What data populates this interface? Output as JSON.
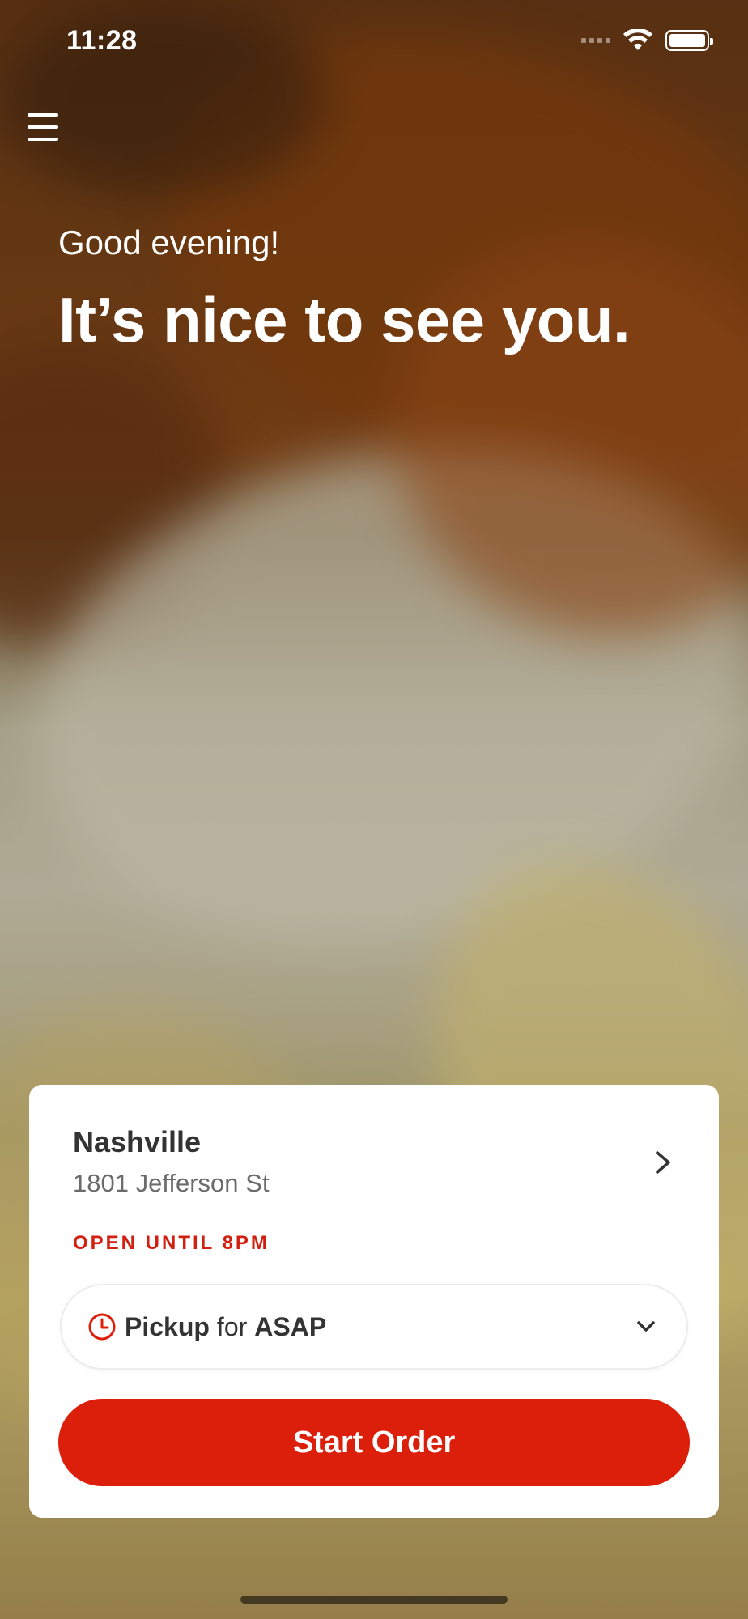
{
  "status_bar": {
    "time": "11:28"
  },
  "icons": {
    "menu": "hamburger-menu-icon",
    "chevron_right": "chevron-right-icon",
    "clock": "clock-icon",
    "chevron_down": "chevron-down-icon",
    "wifi": "wifi-icon",
    "battery": "battery-icon"
  },
  "hero": {
    "greeting": "Good evening!",
    "headline": "It’s nice to see you."
  },
  "location_card": {
    "name": "Nashville",
    "address": "1801 Jefferson St",
    "hours": "OPEN UNTIL 8PM",
    "pickup": {
      "mode": "Pickup",
      "connector": "for",
      "time": "ASAP"
    },
    "start_button": "Start Order"
  },
  "colors": {
    "accent": "#dc1f0b",
    "card_bg": "#ffffff",
    "text_primary": "#333333",
    "text_secondary": "#6b6b6b"
  }
}
